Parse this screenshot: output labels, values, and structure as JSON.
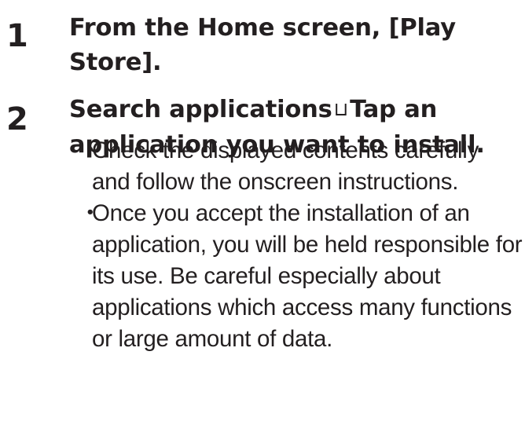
{
  "steps": [
    {
      "number": "1",
      "title": "From the Home screen, [Play Store]."
    },
    {
      "number": "2",
      "title_part1": "Search applications",
      "separator": "⊔",
      "title_part2": "Tap an application you want to install."
    }
  ],
  "notes": {
    "bullet": "・",
    "items": [
      "Check the displayed contents carefully and follow the onscreen instructions.",
      "Once you accept the installation of an application, you will be held responsible for its use. Be careful especially about applications which access many functions or large amount of data."
    ]
  }
}
